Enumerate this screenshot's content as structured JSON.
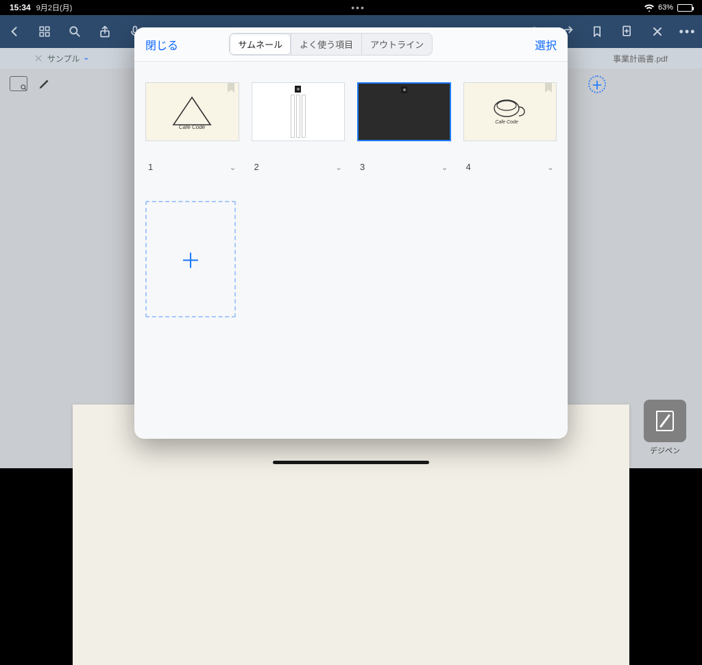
{
  "status": {
    "time": "15:34",
    "date": "9月2日(月)",
    "battery_pct": "63%"
  },
  "tabs": {
    "left_label": "サンプル",
    "right_label": "事業計画書.pdf"
  },
  "popover": {
    "close": "閉じる",
    "select": "選択",
    "segments": {
      "thumbnails": "サムネール",
      "favorites": "よく使う項目",
      "outline": "アウトライン"
    },
    "pages": [
      {
        "num": "1"
      },
      {
        "num": "2"
      },
      {
        "num": "3"
      },
      {
        "num": "4"
      }
    ]
  },
  "brand": {
    "label": "デジペン"
  }
}
